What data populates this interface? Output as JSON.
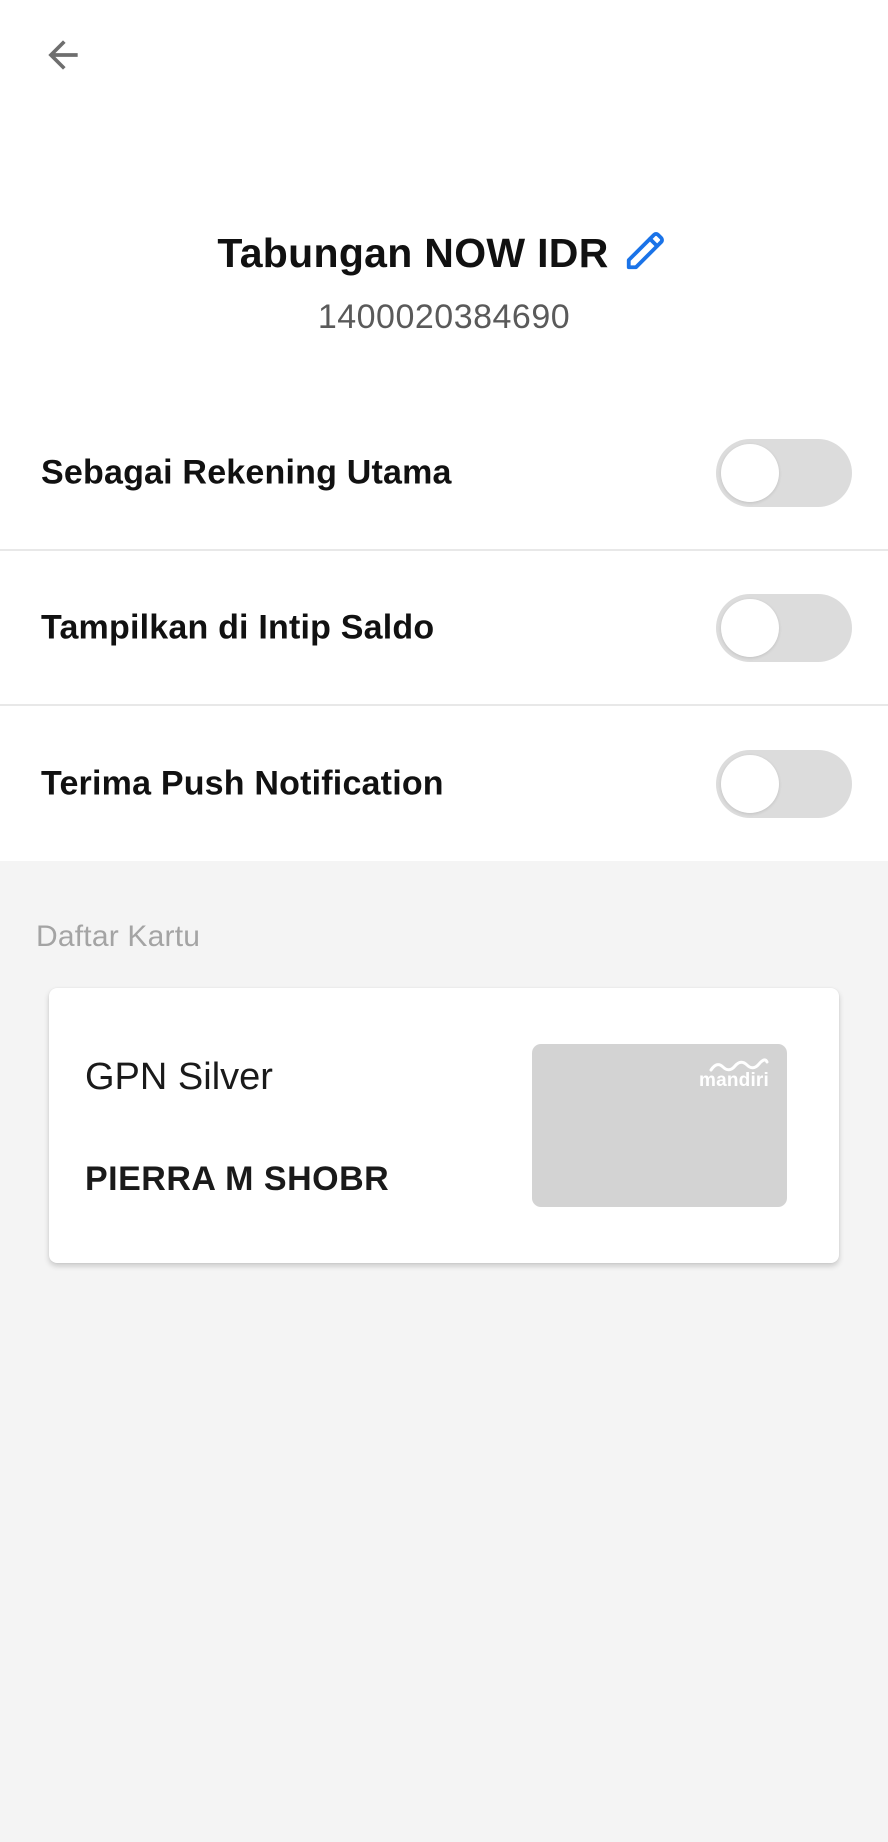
{
  "header": {
    "back_icon": "arrow-left-icon"
  },
  "account": {
    "name": "Tabungan NOW IDR",
    "number": "1400020384690",
    "edit_icon": "pencil-icon",
    "accent_color": "#1a73e8"
  },
  "settings": [
    {
      "label": "Sebagai Rekening Utama",
      "enabled": false
    },
    {
      "label": "Tampilkan di Intip Saldo",
      "enabled": false
    },
    {
      "label": "Terima Push Notification",
      "enabled": false
    }
  ],
  "cards_section": {
    "title": "Daftar Kartu",
    "cards": [
      {
        "type": "GPN Silver",
        "holder": "PIERRA M SHOBR",
        "logo_text": "mandiri"
      }
    ]
  }
}
